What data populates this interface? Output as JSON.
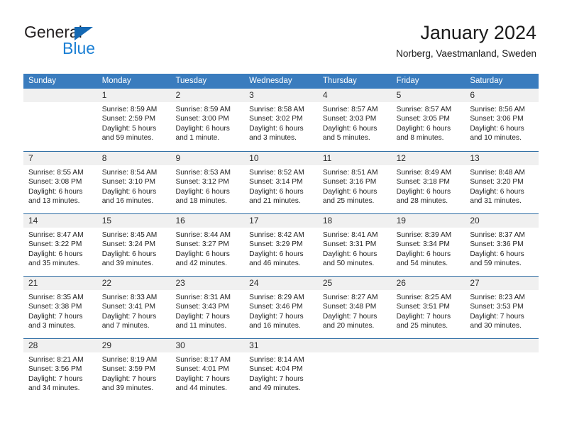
{
  "brand": {
    "name_part1": "General",
    "name_part2": "Blue",
    "colors": {
      "dark": "#231f20",
      "blue": "#1b7fd4",
      "triangle": "#1569b4"
    }
  },
  "header": {
    "title": "January 2024",
    "subtitle": "Norberg, Vaestmanland, Sweden"
  },
  "theme": {
    "header_row_bg": "#3a7cbe",
    "header_row_text": "#ffffff",
    "row_divider": "#2e6da4",
    "day_band_bg": "#f0f0f0"
  },
  "weekdays": [
    "Sunday",
    "Monday",
    "Tuesday",
    "Wednesday",
    "Thursday",
    "Friday",
    "Saturday"
  ],
  "weeks": [
    [
      {
        "day": "",
        "sunrise": "",
        "sunset": "",
        "daylight_line1": "",
        "daylight_line2": ""
      },
      {
        "day": "1",
        "sunrise": "Sunrise: 8:59 AM",
        "sunset": "Sunset: 2:59 PM",
        "daylight_line1": "Daylight: 5 hours",
        "daylight_line2": "and 59 minutes."
      },
      {
        "day": "2",
        "sunrise": "Sunrise: 8:59 AM",
        "sunset": "Sunset: 3:00 PM",
        "daylight_line1": "Daylight: 6 hours",
        "daylight_line2": "and 1 minute."
      },
      {
        "day": "3",
        "sunrise": "Sunrise: 8:58 AM",
        "sunset": "Sunset: 3:02 PM",
        "daylight_line1": "Daylight: 6 hours",
        "daylight_line2": "and 3 minutes."
      },
      {
        "day": "4",
        "sunrise": "Sunrise: 8:57 AM",
        "sunset": "Sunset: 3:03 PM",
        "daylight_line1": "Daylight: 6 hours",
        "daylight_line2": "and 5 minutes."
      },
      {
        "day": "5",
        "sunrise": "Sunrise: 8:57 AM",
        "sunset": "Sunset: 3:05 PM",
        "daylight_line1": "Daylight: 6 hours",
        "daylight_line2": "and 8 minutes."
      },
      {
        "day": "6",
        "sunrise": "Sunrise: 8:56 AM",
        "sunset": "Sunset: 3:06 PM",
        "daylight_line1": "Daylight: 6 hours",
        "daylight_line2": "and 10 minutes."
      }
    ],
    [
      {
        "day": "7",
        "sunrise": "Sunrise: 8:55 AM",
        "sunset": "Sunset: 3:08 PM",
        "daylight_line1": "Daylight: 6 hours",
        "daylight_line2": "and 13 minutes."
      },
      {
        "day": "8",
        "sunrise": "Sunrise: 8:54 AM",
        "sunset": "Sunset: 3:10 PM",
        "daylight_line1": "Daylight: 6 hours",
        "daylight_line2": "and 16 minutes."
      },
      {
        "day": "9",
        "sunrise": "Sunrise: 8:53 AM",
        "sunset": "Sunset: 3:12 PM",
        "daylight_line1": "Daylight: 6 hours",
        "daylight_line2": "and 18 minutes."
      },
      {
        "day": "10",
        "sunrise": "Sunrise: 8:52 AM",
        "sunset": "Sunset: 3:14 PM",
        "daylight_line1": "Daylight: 6 hours",
        "daylight_line2": "and 21 minutes."
      },
      {
        "day": "11",
        "sunrise": "Sunrise: 8:51 AM",
        "sunset": "Sunset: 3:16 PM",
        "daylight_line1": "Daylight: 6 hours",
        "daylight_line2": "and 25 minutes."
      },
      {
        "day": "12",
        "sunrise": "Sunrise: 8:49 AM",
        "sunset": "Sunset: 3:18 PM",
        "daylight_line1": "Daylight: 6 hours",
        "daylight_line2": "and 28 minutes."
      },
      {
        "day": "13",
        "sunrise": "Sunrise: 8:48 AM",
        "sunset": "Sunset: 3:20 PM",
        "daylight_line1": "Daylight: 6 hours",
        "daylight_line2": "and 31 minutes."
      }
    ],
    [
      {
        "day": "14",
        "sunrise": "Sunrise: 8:47 AM",
        "sunset": "Sunset: 3:22 PM",
        "daylight_line1": "Daylight: 6 hours",
        "daylight_line2": "and 35 minutes."
      },
      {
        "day": "15",
        "sunrise": "Sunrise: 8:45 AM",
        "sunset": "Sunset: 3:24 PM",
        "daylight_line1": "Daylight: 6 hours",
        "daylight_line2": "and 39 minutes."
      },
      {
        "day": "16",
        "sunrise": "Sunrise: 8:44 AM",
        "sunset": "Sunset: 3:27 PM",
        "daylight_line1": "Daylight: 6 hours",
        "daylight_line2": "and 42 minutes."
      },
      {
        "day": "17",
        "sunrise": "Sunrise: 8:42 AM",
        "sunset": "Sunset: 3:29 PM",
        "daylight_line1": "Daylight: 6 hours",
        "daylight_line2": "and 46 minutes."
      },
      {
        "day": "18",
        "sunrise": "Sunrise: 8:41 AM",
        "sunset": "Sunset: 3:31 PM",
        "daylight_line1": "Daylight: 6 hours",
        "daylight_line2": "and 50 minutes."
      },
      {
        "day": "19",
        "sunrise": "Sunrise: 8:39 AM",
        "sunset": "Sunset: 3:34 PM",
        "daylight_line1": "Daylight: 6 hours",
        "daylight_line2": "and 54 minutes."
      },
      {
        "day": "20",
        "sunrise": "Sunrise: 8:37 AM",
        "sunset": "Sunset: 3:36 PM",
        "daylight_line1": "Daylight: 6 hours",
        "daylight_line2": "and 59 minutes."
      }
    ],
    [
      {
        "day": "21",
        "sunrise": "Sunrise: 8:35 AM",
        "sunset": "Sunset: 3:38 PM",
        "daylight_line1": "Daylight: 7 hours",
        "daylight_line2": "and 3 minutes."
      },
      {
        "day": "22",
        "sunrise": "Sunrise: 8:33 AM",
        "sunset": "Sunset: 3:41 PM",
        "daylight_line1": "Daylight: 7 hours",
        "daylight_line2": "and 7 minutes."
      },
      {
        "day": "23",
        "sunrise": "Sunrise: 8:31 AM",
        "sunset": "Sunset: 3:43 PM",
        "daylight_line1": "Daylight: 7 hours",
        "daylight_line2": "and 11 minutes."
      },
      {
        "day": "24",
        "sunrise": "Sunrise: 8:29 AM",
        "sunset": "Sunset: 3:46 PM",
        "daylight_line1": "Daylight: 7 hours",
        "daylight_line2": "and 16 minutes."
      },
      {
        "day": "25",
        "sunrise": "Sunrise: 8:27 AM",
        "sunset": "Sunset: 3:48 PM",
        "daylight_line1": "Daylight: 7 hours",
        "daylight_line2": "and 20 minutes."
      },
      {
        "day": "26",
        "sunrise": "Sunrise: 8:25 AM",
        "sunset": "Sunset: 3:51 PM",
        "daylight_line1": "Daylight: 7 hours",
        "daylight_line2": "and 25 minutes."
      },
      {
        "day": "27",
        "sunrise": "Sunrise: 8:23 AM",
        "sunset": "Sunset: 3:53 PM",
        "daylight_line1": "Daylight: 7 hours",
        "daylight_line2": "and 30 minutes."
      }
    ],
    [
      {
        "day": "28",
        "sunrise": "Sunrise: 8:21 AM",
        "sunset": "Sunset: 3:56 PM",
        "daylight_line1": "Daylight: 7 hours",
        "daylight_line2": "and 34 minutes."
      },
      {
        "day": "29",
        "sunrise": "Sunrise: 8:19 AM",
        "sunset": "Sunset: 3:59 PM",
        "daylight_line1": "Daylight: 7 hours",
        "daylight_line2": "and 39 minutes."
      },
      {
        "day": "30",
        "sunrise": "Sunrise: 8:17 AM",
        "sunset": "Sunset: 4:01 PM",
        "daylight_line1": "Daylight: 7 hours",
        "daylight_line2": "and 44 minutes."
      },
      {
        "day": "31",
        "sunrise": "Sunrise: 8:14 AM",
        "sunset": "Sunset: 4:04 PM",
        "daylight_line1": "Daylight: 7 hours",
        "daylight_line2": "and 49 minutes."
      },
      {
        "day": "",
        "sunrise": "",
        "sunset": "",
        "daylight_line1": "",
        "daylight_line2": ""
      },
      {
        "day": "",
        "sunrise": "",
        "sunset": "",
        "daylight_line1": "",
        "daylight_line2": ""
      },
      {
        "day": "",
        "sunrise": "",
        "sunset": "",
        "daylight_line1": "",
        "daylight_line2": ""
      }
    ]
  ]
}
